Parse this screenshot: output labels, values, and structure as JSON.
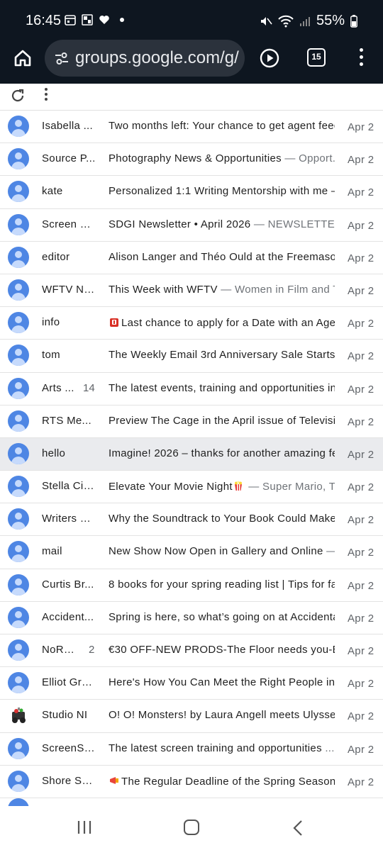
{
  "status_bar": {
    "time": "16:45",
    "battery": "55%"
  },
  "browser": {
    "url": "groups.google.com/g/",
    "tab_count": "15",
    "icons": [
      "home-icon",
      "tune-icon",
      "play-circle-icon",
      "tabs-icon",
      "more-vert-icon"
    ]
  },
  "actions": {
    "icons": [
      "refresh-icon",
      "more-vert-icon"
    ]
  },
  "threads": [
    {
      "sender": "Isabella ...",
      "count": "",
      "subject": "Two months left: Your chance to get agent feed",
      "snippet": "",
      "date": "Apr 2"
    },
    {
      "sender": "Source P...",
      "count": "",
      "subject": "Photography News & Opportunities",
      "snippet": " — Opport...",
      "date": "Apr 2"
    },
    {
      "sender": "kate",
      "count": "",
      "subject": "Personalized 1:1 Writing Mentorship with me —",
      "snippet": "",
      "date": "Apr 2"
    },
    {
      "sender": "Screen Di...",
      "count": "",
      "subject": "SDGI Newsletter • April 2026",
      "snippet": " — NEWSLETTER...",
      "date": "Apr 2"
    },
    {
      "sender": "editor",
      "count": "",
      "subject": "Alison Langer and Théo Ould at the Freemason'",
      "snippet": "",
      "date": "Apr 2"
    },
    {
      "sender": "WFTV Ne...",
      "count": "",
      "subject": "This Week with WFTV",
      "snippet": " — Women in Film and T...",
      "date": "Apr 2"
    },
    {
      "sender": "info",
      "count": "",
      "subject": "Last chance to apply for a Date with an Agen",
      "snippet": "",
      "date": "Apr 2"
    },
    {
      "sender": "tom",
      "count": "",
      "subject": "The Weekly Email 3rd Anniversary Sale Starts n",
      "snippet": "",
      "date": "Apr 2"
    },
    {
      "sender": "Arts ...",
      "count": "14",
      "subject": "The latest events, training and opportunities in",
      "snippet": "",
      "date": "Apr 2"
    },
    {
      "sender": "RTS Me...",
      "count": "",
      "subject": "Preview The Cage in the April issue of Televisio",
      "snippet": "",
      "date": "Apr 2"
    },
    {
      "sender": "hello",
      "count": "",
      "subject": "Imagine! 2026 – thanks for another amazing fe",
      "snippet": "",
      "date": "Apr 2"
    },
    {
      "sender": "Stella Cin...",
      "count": "",
      "subject": "Elevate Your Movie Night",
      "snippet": " — Super Mario, T...",
      "date": "Apr 2"
    },
    {
      "sender": "Writers D...",
      "count": "",
      "subject": "Why the Soundtrack to Your Book Could Make A",
      "snippet": "",
      "date": "Apr 2"
    },
    {
      "sender": "mail",
      "count": "",
      "subject": "New Show Now Open in Gallery and Online",
      "snippet": " — ...",
      "date": "Apr 2"
    },
    {
      "sender": "Curtis Br...",
      "count": "",
      "subject": "8 books for your spring reading list | Tips for fa",
      "snippet": "",
      "date": "Apr 2"
    },
    {
      "sender": "Accident...",
      "count": "",
      "subject": "Spring is here, so what’s going on at Accidental",
      "snippet": "",
      "date": "Apr 2"
    },
    {
      "sender": "NoRepl...",
      "count": "2",
      "subject": "€30 OFF-NEW PRODS-The Floor needs you-Ban",
      "snippet": "",
      "date": "Apr 2"
    },
    {
      "sender": "Elliot Gro...",
      "count": "",
      "subject": "Here's How You Can Meet the Right People in F",
      "snippet": "",
      "date": "Apr 2"
    },
    {
      "sender": "Studio NI",
      "count": "",
      "subject": "O! O! Monsters! by Laura Angell meets Ulysses b",
      "snippet": "",
      "date": "Apr 2"
    },
    {
      "sender": "ScreenSk...",
      "count": "",
      "subject": "The latest screen training and opportunities",
      "snippet": " ...",
      "date": "Apr 2"
    },
    {
      "sender": "Shore Sc...",
      "count": "",
      "subject": "The Regular Deadline of the Spring Season S",
      "snippet": "",
      "date": "Apr 2"
    }
  ],
  "colors": {
    "status_bg": "#0e1620",
    "url_pill": "#2b323c",
    "avatar_blue": "#4e86e4",
    "selected_row": "#eaebee"
  },
  "nav": {
    "icons": [
      "recent-apps-icon",
      "home-circle-icon",
      "back-icon"
    ]
  }
}
